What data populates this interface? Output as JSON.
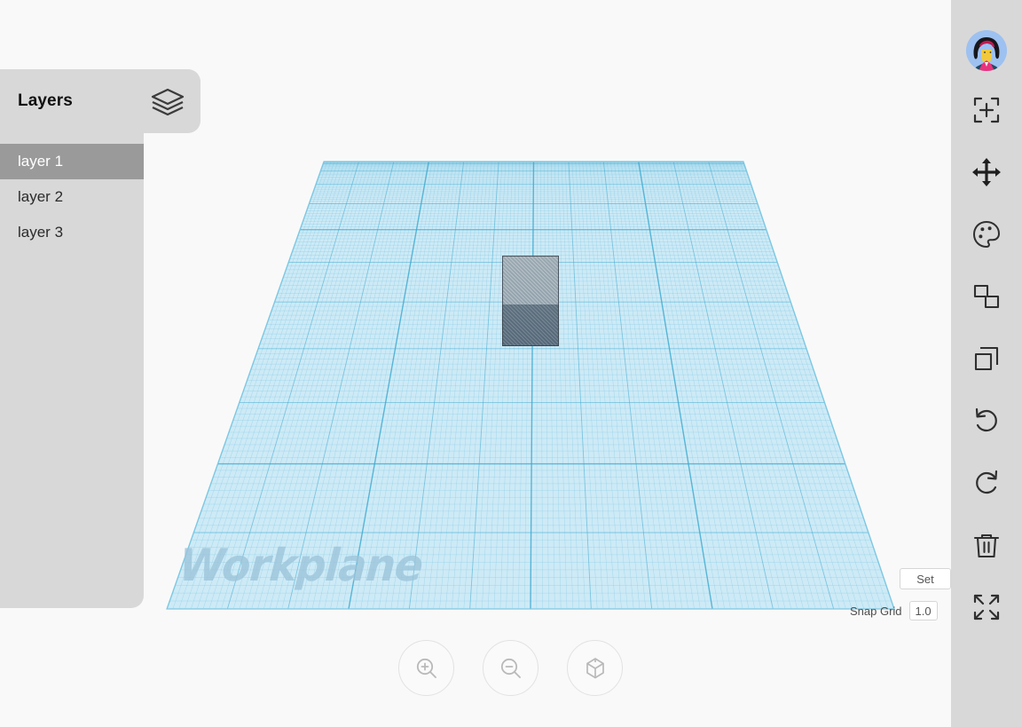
{
  "app": {
    "canvas_background": "#f9f9f9",
    "panel_background": "#d8d8d8",
    "accent_selected": "#9a9a9a"
  },
  "layers_panel": {
    "title": "Layers",
    "stack_icon": "layers-stack-icon",
    "items": [
      {
        "label": "layer 1",
        "selected": true
      },
      {
        "label": "layer 2",
        "selected": false
      },
      {
        "label": "layer 3",
        "selected": false
      }
    ]
  },
  "workplane": {
    "watermark": "Workplane",
    "grid_color": "#3aa8cf",
    "plane_fill": "#cdeaf6"
  },
  "scene": {
    "objects": [
      {
        "name": "box",
        "type": "cube",
        "top_color": "#96a5ae",
        "front_color": "#5a6d7c"
      }
    ]
  },
  "view_controls": [
    {
      "name": "zoom-in-button",
      "icon": "zoom-in-icon"
    },
    {
      "name": "zoom-out-button",
      "icon": "zoom-out-icon"
    },
    {
      "name": "fit-view-button",
      "icon": "cube-view-icon"
    }
  ],
  "settings": {
    "button_label": "Set",
    "snap_grid_label": "Snap Grid",
    "snap_grid_value": "1.0"
  },
  "toolbar": {
    "avatar_name": "user-avatar",
    "tools": [
      {
        "name": "add-shape-button",
        "icon": "add-frame-icon"
      },
      {
        "name": "move-button",
        "icon": "move-arrows-icon"
      },
      {
        "name": "color-button",
        "icon": "palette-icon"
      },
      {
        "name": "group-button",
        "icon": "group-shapes-icon"
      },
      {
        "name": "duplicate-button",
        "icon": "duplicate-icon"
      },
      {
        "name": "undo-button",
        "icon": "undo-icon"
      },
      {
        "name": "redo-button",
        "icon": "redo-icon"
      },
      {
        "name": "delete-button",
        "icon": "trash-icon"
      },
      {
        "name": "fullscreen-button",
        "icon": "fullscreen-icon"
      }
    ]
  }
}
